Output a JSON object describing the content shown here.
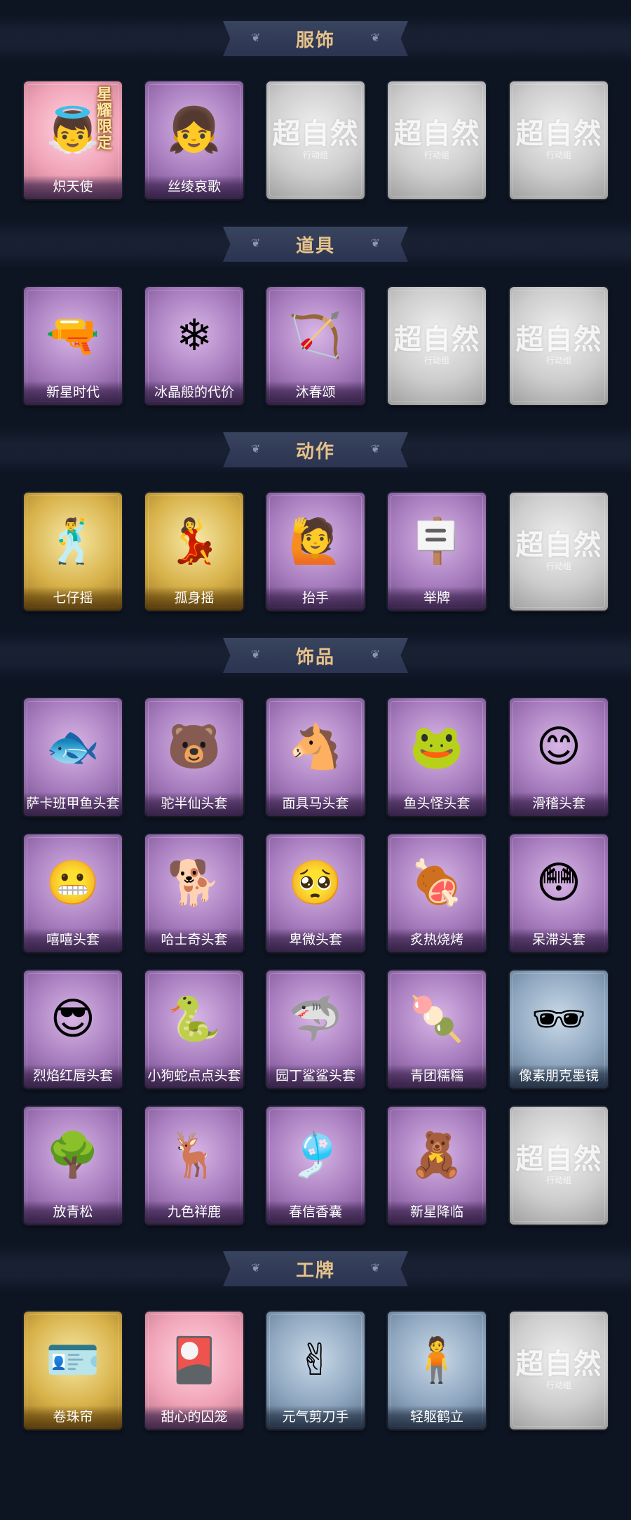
{
  "sections": [
    {
      "title": "服饰",
      "items": [
        {
          "label": "炽天使",
          "style": "pink",
          "icon": "angel-portrait-icon",
          "glyph": "👼",
          "badge": "星耀限定"
        },
        {
          "label": "丝绫哀歌",
          "style": "purple",
          "icon": "girl-portrait-icon",
          "glyph": "👧"
        },
        {
          "placeholder": "超自然",
          "placeholder_sub": "行动组",
          "style": "grey"
        },
        {
          "placeholder": "超自然",
          "placeholder_sub": "行动组",
          "style": "grey"
        },
        {
          "placeholder": "超自然",
          "placeholder_sub": "行动组",
          "style": "grey"
        }
      ]
    },
    {
      "title": "道具",
      "items": [
        {
          "label": "新星时代",
          "style": "purple",
          "icon": "revolver-icon",
          "glyph": "🔫"
        },
        {
          "label": "冰晶般的代价",
          "style": "purple",
          "icon": "ice-lotus-icon",
          "glyph": "❄"
        },
        {
          "label": "沐春颂",
          "style": "purple",
          "icon": "flower-bow-icon",
          "glyph": "🏹"
        },
        {
          "placeholder": "超自然",
          "placeholder_sub": "行动组",
          "style": "grey"
        },
        {
          "placeholder": "超自然",
          "placeholder_sub": "行动组",
          "style": "grey"
        }
      ]
    },
    {
      "title": "动作",
      "items": [
        {
          "label": "七仔摇",
          "style": "gold",
          "icon": "dance-pose-icon",
          "glyph": "🕺"
        },
        {
          "label": "孤身摇",
          "style": "gold",
          "icon": "solo-dance-icon",
          "glyph": "💃"
        },
        {
          "label": "抬手",
          "style": "purple",
          "icon": "raise-hand-icon",
          "glyph": "🙋"
        },
        {
          "label": "举牌",
          "style": "purple",
          "icon": "hold-sign-icon",
          "glyph": "🪧"
        },
        {
          "placeholder": "超自然",
          "placeholder_sub": "行动组",
          "style": "grey"
        }
      ]
    },
    {
      "title": "饰品",
      "items": [
        {
          "label": "萨卡班甲鱼头套",
          "style": "purple",
          "icon": "fish-head-icon",
          "glyph": "🐟"
        },
        {
          "label": "驼半仙头套",
          "style": "purple",
          "icon": "bear-head-icon",
          "glyph": "🐻"
        },
        {
          "label": "面具马头套",
          "style": "purple",
          "icon": "horse-head-icon",
          "glyph": "🐴"
        },
        {
          "label": "鱼头怪头套",
          "style": "purple",
          "icon": "frog-fish-head-icon",
          "glyph": "🐸"
        },
        {
          "label": "滑稽头套",
          "style": "purple",
          "icon": "smile-emoji-icon",
          "glyph": "😊"
        },
        {
          "label": "嘻嘻头套",
          "style": "purple",
          "icon": "grin-emoji-icon",
          "glyph": "😬"
        },
        {
          "label": "哈士奇头套",
          "style": "purple",
          "icon": "dog-head-icon",
          "glyph": "🐕"
        },
        {
          "label": "卑微头套",
          "style": "purple",
          "icon": "sad-emoji-icon",
          "glyph": "🥺"
        },
        {
          "label": "炙热烧烤",
          "style": "purple",
          "icon": "bbq-icon",
          "glyph": "🍖"
        },
        {
          "label": "呆滞头套",
          "style": "purple",
          "icon": "dazed-emoji-icon",
          "glyph": "😳"
        },
        {
          "label": "烈焰红唇头套",
          "style": "purple",
          "icon": "pikachu-head-icon",
          "glyph": "😎"
        },
        {
          "label": "小狗蛇点点头套",
          "style": "purple",
          "icon": "snake-head-icon",
          "glyph": "🐍"
        },
        {
          "label": "园丁鲨鲨头套",
          "style": "purple",
          "icon": "shark-head-icon",
          "glyph": "🦈"
        },
        {
          "label": "青团糯糯",
          "style": "purple",
          "icon": "green-dumpling-icon",
          "glyph": "🍡"
        },
        {
          "label": "像素朋克墨镜",
          "style": "blue",
          "icon": "pixel-sunglasses-icon",
          "glyph": "🕶"
        },
        {
          "label": "放青松",
          "style": "purple",
          "icon": "potted-pine-icon",
          "glyph": "🌳"
        },
        {
          "label": "九色祥鹿",
          "style": "purple",
          "icon": "deer-charm-icon",
          "glyph": "🦌"
        },
        {
          "label": "春信香囊",
          "style": "purple",
          "icon": "sachet-icon",
          "glyph": "🎐"
        },
        {
          "label": "新星降临",
          "style": "purple",
          "icon": "doll-charm-icon",
          "glyph": "🧸"
        },
        {
          "placeholder": "超自然",
          "placeholder_sub": "行动组",
          "style": "grey"
        }
      ]
    },
    {
      "title": "工牌",
      "items": [
        {
          "label": "卷珠帘",
          "style": "gold",
          "icon": "badge-card-icon",
          "glyph": "🪪"
        },
        {
          "label": "甜心的囚笼",
          "style": "pink",
          "icon": "heart-cage-card-icon",
          "glyph": "🎴"
        },
        {
          "label": "元气剪刀手",
          "style": "blue",
          "icon": "silhouette-card-icon",
          "glyph": "✌"
        },
        {
          "label": "轻躯鹤立",
          "style": "blue",
          "icon": "silhouette-card-icon",
          "glyph": "🧍"
        },
        {
          "placeholder": "超自然",
          "placeholder_sub": "行动组",
          "style": "grey"
        }
      ]
    }
  ]
}
